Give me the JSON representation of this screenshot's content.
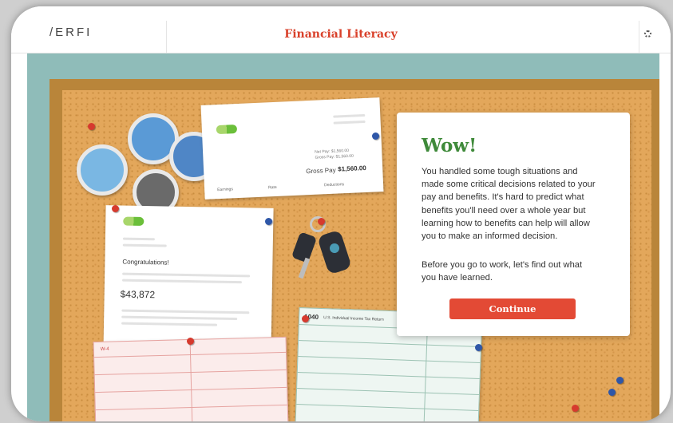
{
  "header": {
    "logo": "/ERFI",
    "title": "Financial Literacy"
  },
  "paystub": {
    "row1": "Net Pay: $1,560.00",
    "row2": "Gross Pay: $1,560.00",
    "gross_label": "Gross Pay",
    "gross_value": "$1,560.00",
    "col1": "Earnings",
    "col2": "Rate",
    "col3": "Deductions"
  },
  "offer_letter": {
    "greeting": "Congratulations!",
    "salary": "$43,872"
  },
  "tax_form": {
    "form_number": "1040",
    "form_title": "U.S. Individual Income Tax Return"
  },
  "w4_form": {
    "label": "W-4"
  },
  "dialog": {
    "heading": "Wow!",
    "paragraph1": "You handled some tough situations and made some critical decisions related to your pay and benefits. It's hard to predict what benefits you'll need over a whole year but learning how to benefits can help will allow you to make an informed decision.",
    "paragraph2": "Before you go to work, let's find out what you have learned.",
    "continue_label": "Continue"
  },
  "colors": {
    "accent": "#e34a35",
    "heading_green": "#3f8a3a",
    "title_red": "#d9412b",
    "cork": "#e3a75b",
    "frame_wood": "#b9853a"
  }
}
